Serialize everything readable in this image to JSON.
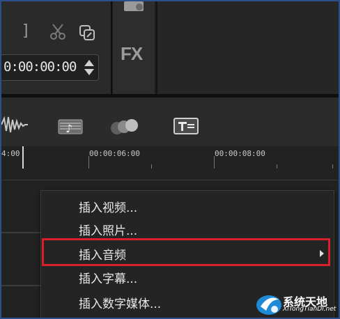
{
  "preview": {
    "bracket_label": "]",
    "timecode": "0:00:00:00"
  },
  "tools": {
    "fx_label": "FX"
  },
  "timeline": {
    "ruler_labels": [
      "4:00",
      "00:00:06:00",
      "00:00:08:00"
    ]
  },
  "context_menu": {
    "items": [
      {
        "label": "插入视频...",
        "has_submenu": false
      },
      {
        "label": "插入照片...",
        "has_submenu": false
      },
      {
        "label": "插入音频",
        "has_submenu": true
      },
      {
        "label": "插入字幕...",
        "has_submenu": false
      },
      {
        "label": "插入数字媒体...",
        "has_submenu": false
      }
    ]
  },
  "watermark": {
    "title": "系统天地",
    "subtitle": "XiTongTianDi.net"
  },
  "colors": {
    "highlight": "#d8202a",
    "frame_border": "#2b4f8a"
  }
}
